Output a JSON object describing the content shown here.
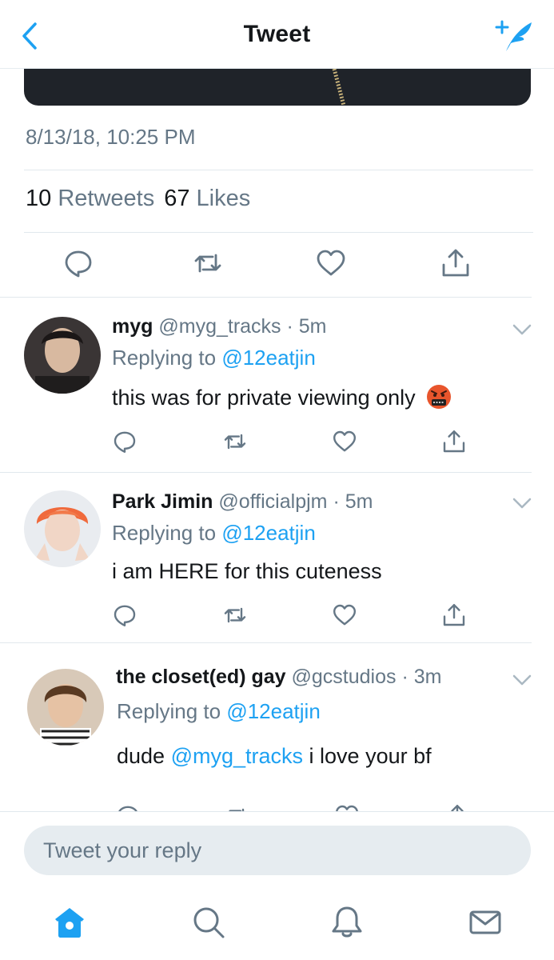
{
  "header": {
    "title": "Tweet",
    "back_icon": "chevron-left-icon",
    "compose_icon": "compose-tweet-icon",
    "accent_color": "#1da1f2"
  },
  "tweet": {
    "timestamp": "8/13/18, 10:25 PM",
    "retweets_count": "10",
    "retweets_label": "Retweets",
    "likes_count": "67",
    "likes_label": "Likes",
    "actions": [
      "reply-icon",
      "retweet-icon",
      "like-icon",
      "share-icon"
    ]
  },
  "replies": [
    {
      "name": "myg",
      "handle": "@myg_tracks",
      "time": "· 5m",
      "replying_label": "Replying to",
      "replying_to": "@12eatjin",
      "text": "this was for private viewing only",
      "emoji": "cursing-face-emoji"
    },
    {
      "name": "Park Jimin",
      "handle": "@officialpjm",
      "time": "· 5m",
      "replying_label": "Replying to",
      "replying_to": "@12eatjin",
      "text": "i am HERE for this cuteness"
    },
    {
      "name": "the closet(ed) gay",
      "handle": "@gcstudios",
      "time": "· 3m",
      "replying_label": "Replying to",
      "replying_to": "@12eatjin",
      "text_before": "dude ",
      "text_mention": "@myg_tracks",
      "text_after": " i love your bf"
    }
  ],
  "composer": {
    "placeholder": "Tweet your reply"
  },
  "tabbar": {
    "items": [
      "home-icon",
      "search-icon",
      "notifications-icon",
      "messages-icon"
    ],
    "active": "home-icon"
  }
}
